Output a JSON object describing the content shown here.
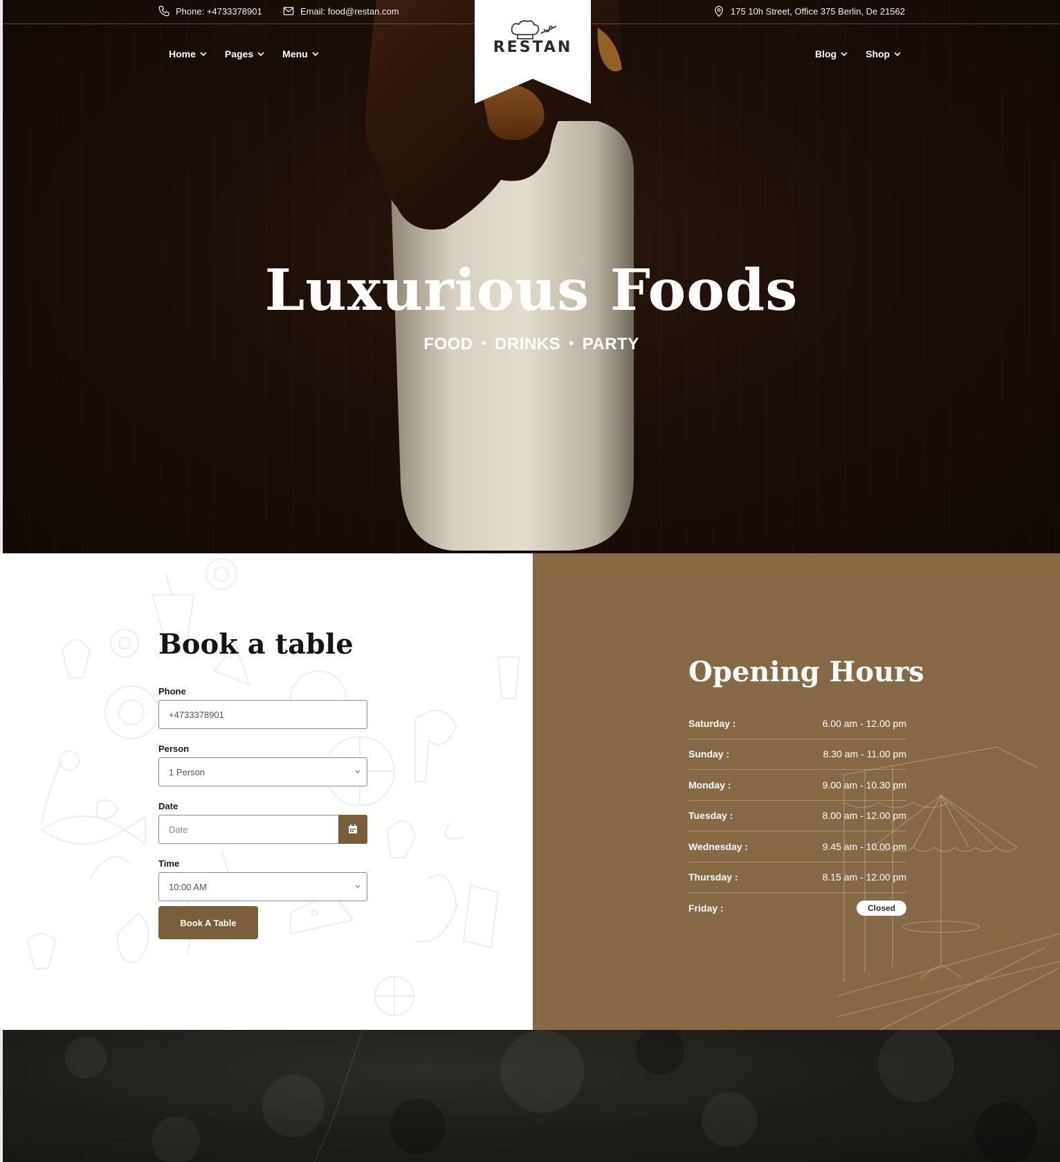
{
  "topbar": {
    "phone": "Phone: +4733378901",
    "email": "Email: food@restan.com",
    "address": "175 10h Street, Office 375 Berlin, De 21562"
  },
  "logo": {
    "text": "RESTAN"
  },
  "nav": {
    "left": [
      "Home",
      "Pages",
      "Menu"
    ],
    "right": [
      "Blog",
      "Shop"
    ]
  },
  "hero": {
    "title": "Luxurious Foods",
    "subtitle": [
      "FOOD",
      "DRINKS",
      "PARTY"
    ]
  },
  "booking": {
    "title": "Book a table",
    "phone_label": "Phone",
    "phone_value": "+4733378901",
    "person_label": "Person",
    "person_value": "1 Person",
    "date_label": "Date",
    "date_placeholder": "Date",
    "time_label": "Time",
    "time_value": "10:00 AM",
    "submit": "Book A Table"
  },
  "hours": {
    "title": "Opening Hours",
    "rows": [
      {
        "day": "Saturday :",
        "time": "6.00 am - 12.00 pm"
      },
      {
        "day": "Sunday :",
        "time": "8.30 am - 11.00 pm"
      },
      {
        "day": "Monday :",
        "time": "9.00 am - 10.30 pm"
      },
      {
        "day": "Tuesday :",
        "time": "8.00 am - 12.00 pm"
      },
      {
        "day": "Wednesday :",
        "time": "9.45 am - 10.00 pm"
      },
      {
        "day": "Thursday :",
        "time": "8.15 am - 12.00 pm"
      },
      {
        "day": "Friday :",
        "time": "Closed"
      }
    ]
  },
  "colors": {
    "accent_brown": "#7a5e3a",
    "hours_bg": "#866a46",
    "hero_bg": "#1a0d07"
  },
  "icons": [
    "phone-icon",
    "mail-icon",
    "location-icon",
    "chef-hat-logo-icon",
    "chevron-down-icon",
    "calendar-icon"
  ]
}
